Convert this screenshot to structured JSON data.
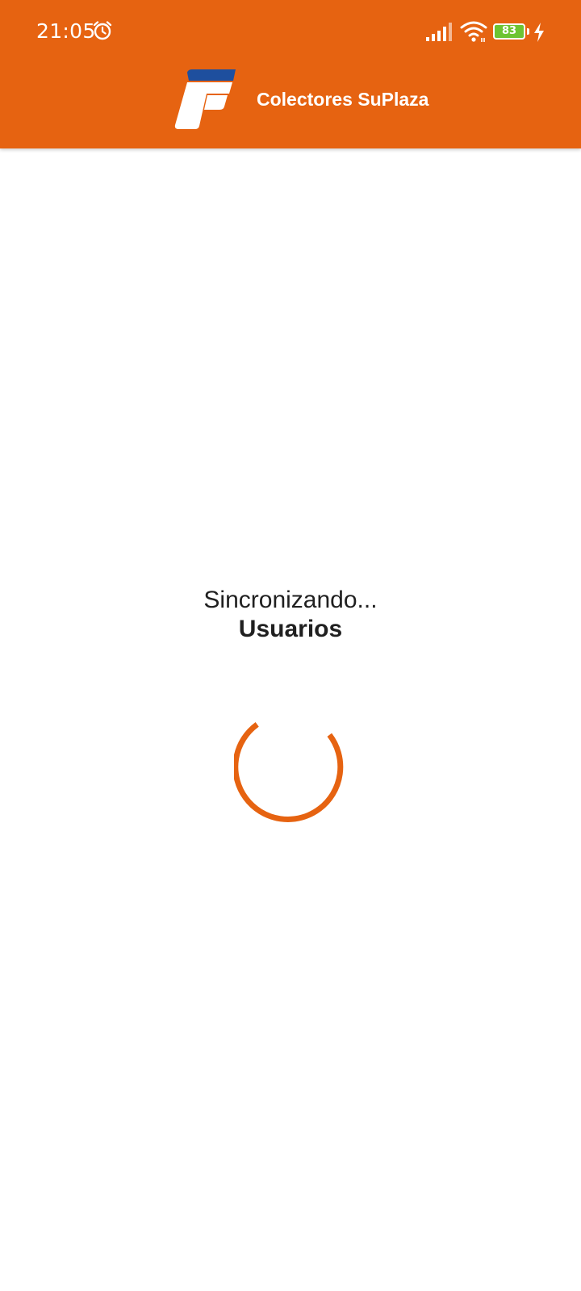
{
  "status_bar": {
    "time": "21:05",
    "battery_level": "83",
    "icons": [
      "alarm-icon",
      "signal-icon",
      "wifi-icon",
      "battery-icon",
      "charge-icon"
    ]
  },
  "app_bar": {
    "title": "Colectores SuPlaza",
    "logo_icon": "suplaza-logo"
  },
  "sync": {
    "message": "Sincronizando...",
    "item": "Usuarios",
    "spinner_icon": "loading-spinner"
  },
  "colors": {
    "primary": "#E66311",
    "logo_blue": "#1E4F9E",
    "background": "#FFFFFF",
    "text": "#202020",
    "battery_fill": "#6DC432"
  }
}
